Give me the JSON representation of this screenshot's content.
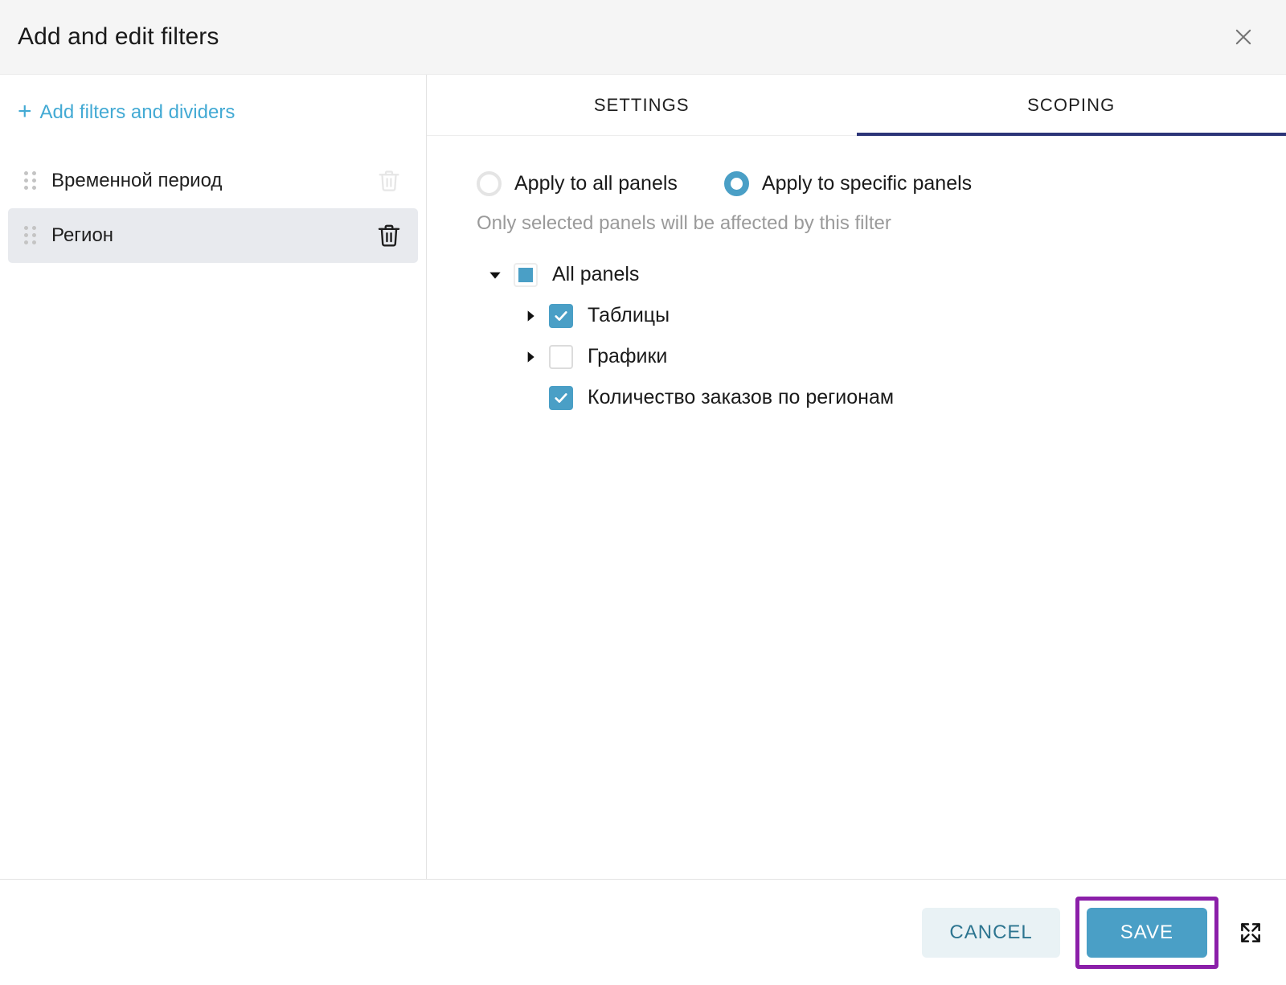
{
  "dialog": {
    "title": "Add and edit filters",
    "close_icon": "close-icon"
  },
  "sidebar": {
    "add_link": "Add filters and dividers",
    "add_icon": "plus-icon",
    "filters": [
      {
        "label": "Временной период",
        "selected": false,
        "trash_icon": "trash-icon",
        "drag_icon": "drag-handle-icon"
      },
      {
        "label": "Регион",
        "selected": true,
        "trash_icon": "trash-icon",
        "drag_icon": "drag-handle-icon"
      }
    ]
  },
  "tabs": [
    {
      "label": "SETTINGS",
      "active": false
    },
    {
      "label": "SCOPING",
      "active": true
    }
  ],
  "scoping": {
    "radio_options": [
      {
        "label": "Apply to all panels",
        "checked": false
      },
      {
        "label": "Apply to specific panels",
        "checked": true
      }
    ],
    "hint": "Only selected panels will be affected by this filter",
    "tree": [
      {
        "label": "All panels",
        "level": 0,
        "state": "indeterminate",
        "caret": "expanded"
      },
      {
        "label": "Таблицы",
        "level": 1,
        "state": "checked",
        "caret": "collapsed"
      },
      {
        "label": "Графики",
        "level": 1,
        "state": "unchecked",
        "caret": "collapsed"
      },
      {
        "label": "Количество заказов по регионам",
        "level": 1,
        "state": "checked",
        "caret": "none"
      }
    ]
  },
  "footer": {
    "cancel_label": "CANCEL",
    "save_label": "SAVE",
    "expand_icon": "expand-icon"
  },
  "colors": {
    "accent": "#4a9fc6",
    "link": "#43aad4",
    "tab_underline": "#2c3578",
    "highlight_ring": "#8b1fa9",
    "row_selected_bg": "#e8eaee",
    "cancel_bg": "#e9f2f5",
    "cancel_text": "#2d7590",
    "header_bg": "#f5f5f5",
    "hint_text": "#9a9a9a"
  }
}
